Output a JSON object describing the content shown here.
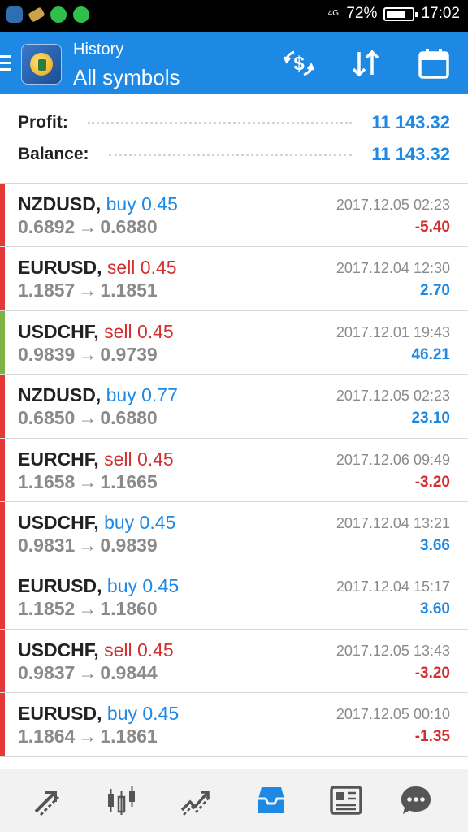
{
  "statusbar": {
    "network": "4G",
    "battery_text": "72%",
    "battery_level": 0.72,
    "time": "17:02",
    "left_icons": [
      "message-icon",
      "brush-icon",
      "whatsapp-icon",
      "whatsapp-icon"
    ]
  },
  "header": {
    "small_title": "History",
    "big_title": "All symbols",
    "actions": [
      "deposit-icon",
      "sort-icon",
      "calendar-icon"
    ]
  },
  "summary": {
    "profit_label": "Profit:",
    "profit_value": "11 143.32",
    "balance_label": "Balance:",
    "balance_value": "11 143.32"
  },
  "arrow": "→",
  "trades": [
    {
      "symbol": "NZDUSD,",
      "side": "buy 0.45",
      "side_type": "buy",
      "open": "0.6892",
      "close": "0.6880",
      "time": "2017.12.05 02:23",
      "profit": "-5.40",
      "bar_color": "#e53935"
    },
    {
      "symbol": "EURUSD,",
      "side": "sell 0.45",
      "side_type": "sell",
      "open": "1.1857",
      "close": "1.1851",
      "time": "2017.12.04 12:30",
      "profit": "2.70",
      "bar_color": "#e53935"
    },
    {
      "symbol": "USDCHF,",
      "side": "sell 0.45",
      "side_type": "sell",
      "open": "0.9839",
      "close": "0.9739",
      "time": "2017.12.01 19:43",
      "profit": "46.21",
      "bar_color": "#7cb342"
    },
    {
      "symbol": "NZDUSD,",
      "side": "buy 0.77",
      "side_type": "buy",
      "open": "0.6850",
      "close": "0.6880",
      "time": "2017.12.05 02:23",
      "profit": "23.10",
      "bar_color": "#e53935"
    },
    {
      "symbol": "EURCHF,",
      "side": "sell 0.45",
      "side_type": "sell",
      "open": "1.1658",
      "close": "1.1665",
      "time": "2017.12.06 09:49",
      "profit": "-3.20",
      "bar_color": "#e53935"
    },
    {
      "symbol": "USDCHF,",
      "side": "buy 0.45",
      "side_type": "buy",
      "open": "0.9831",
      "close": "0.9839",
      "time": "2017.12.04 13:21",
      "profit": "3.66",
      "bar_color": "#e53935"
    },
    {
      "symbol": "EURUSD,",
      "side": "buy 0.45",
      "side_type": "buy",
      "open": "1.1852",
      "close": "1.1860",
      "time": "2017.12.04 15:17",
      "profit": "3.60",
      "bar_color": "#e53935"
    },
    {
      "symbol": "USDCHF,",
      "side": "sell 0.45",
      "side_type": "sell",
      "open": "0.9837",
      "close": "0.9844",
      "time": "2017.12.05 13:43",
      "profit": "-3.20",
      "bar_color": "#e53935"
    },
    {
      "symbol": "EURUSD,",
      "side": "buy 0.45",
      "side_type": "buy",
      "open": "1.1864",
      "close": "1.1861",
      "time": "2017.12.05 00:10",
      "profit": "-1.35",
      "bar_color": "#e53935"
    }
  ],
  "bottom_nav": {
    "items": [
      "quotes-icon",
      "chart-icon",
      "trade-icon",
      "history-icon",
      "news-icon",
      "chat-icon"
    ],
    "active": "history-icon",
    "active_color": "#1e88e5",
    "inactive_color": "#555555"
  }
}
